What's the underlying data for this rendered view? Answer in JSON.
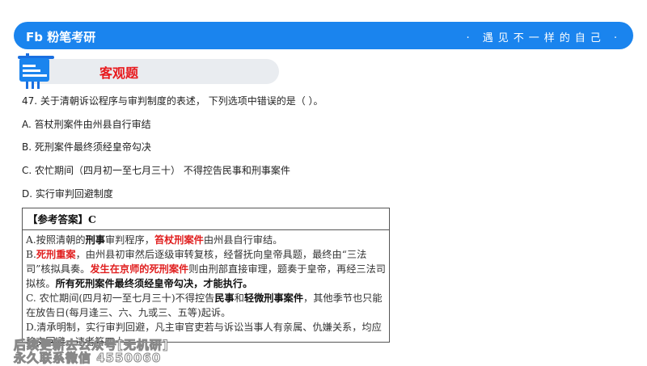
{
  "header": {
    "logo": "粉笔考研",
    "logo_mark": "Fb",
    "slogan": "· 遇见不一样的自己 ·",
    "accent": "#1a84ee"
  },
  "section": {
    "title": "客观题"
  },
  "question": {
    "stem": "47. 关于清朝诉讼程序与审判制度的表述， 下列选项中错误的是（ ）。",
    "options": [
      "A. 笞杖刑案件由州县自行审结",
      "B. 死刑案件最终须经皇帝勾决",
      "C. 农忙期间（四月初一至七月三十） 不得控告民事和刑事案件",
      "D. 实行审判回避制度"
    ]
  },
  "answer": {
    "heading": "【参考答案】C",
    "paragraphs": [
      [
        {
          "t": "A.按照清朝的",
          "s": "n"
        },
        {
          "t": "刑事",
          "s": "b"
        },
        {
          "t": "审判程序，",
          "s": "n"
        },
        {
          "t": "笞杖刑案件",
          "s": "r"
        },
        {
          "t": "由州县自行审结。",
          "s": "n"
        }
      ],
      [
        {
          "t": "B.",
          "s": "n"
        },
        {
          "t": "死刑重案",
          "s": "r"
        },
        {
          "t": "，由州县初审然后逐级审转复核，经督抚向皇帝具题，最终由“三法司”核拟具奏。",
          "s": "n"
        },
        {
          "t": "发生在京师的死刑案件",
          "s": "r"
        },
        {
          "t": "则由刑部直接审理，题奏于皇帝，再经三法司拟核。",
          "s": "n"
        },
        {
          "t": "所有死刑案件最终须经皇帝勾决，才能执行。",
          "s": "b"
        }
      ],
      [
        {
          "t": "C. 农忙期间(四月初一至七月三十)不得控告",
          "s": "n"
        },
        {
          "t": "民事",
          "s": "b"
        },
        {
          "t": "和",
          "s": "n"
        },
        {
          "t": "轻微刑事案件",
          "s": "b"
        },
        {
          "t": "，其他季节也只能在放告日(每月逢三、六、九或三、五等)起诉。",
          "s": "n"
        }
      ],
      [
        {
          "t": "D.清承明制，实行审判回避，凡主审官吏若与诉讼当事人有亲属、仇嫌关系，均应移交回避，违者笞四十。",
          "s": "n"
        }
      ]
    ]
  },
  "watermark": {
    "line1": "后续更新去公众号[无机研]",
    "line2": "永久联系微信 4550060"
  }
}
